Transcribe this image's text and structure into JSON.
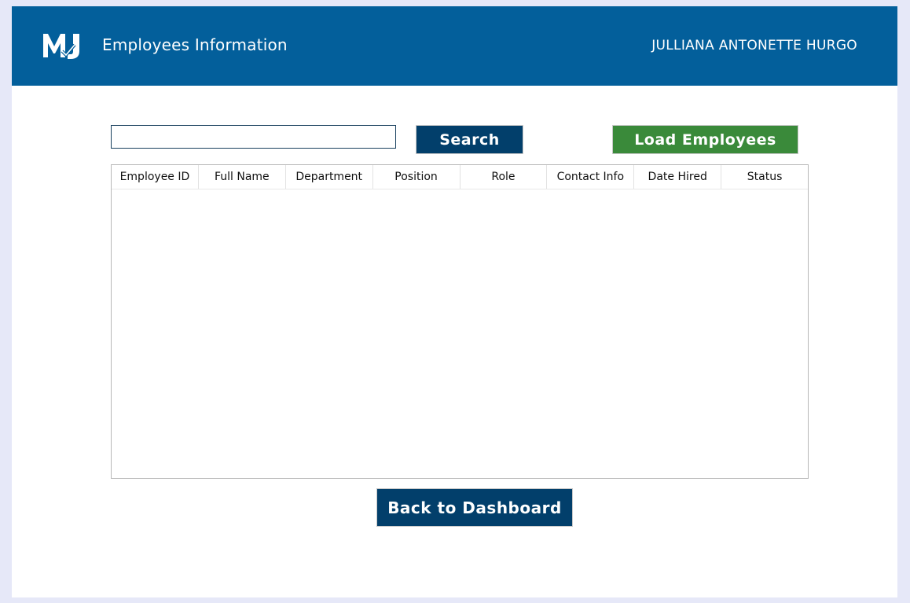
{
  "header": {
    "logo": "MJ logo",
    "title": "Employees Information",
    "username": "JULLIANA ANTONETTE HURGO"
  },
  "search": {
    "value": "",
    "placeholder": "",
    "button_label": "Search"
  },
  "load_button_label": "Load Employees",
  "table": {
    "columns": [
      "Employee ID",
      "Full Name",
      "Department",
      "Position",
      "Role",
      "Contact Info",
      "Date Hired",
      "Status"
    ],
    "rows": []
  },
  "back_button_label": "Back to Dashboard",
  "colors": {
    "header_bg": "#035f9b",
    "primary_button": "#023f6b",
    "load_button": "#3a8a3a"
  }
}
